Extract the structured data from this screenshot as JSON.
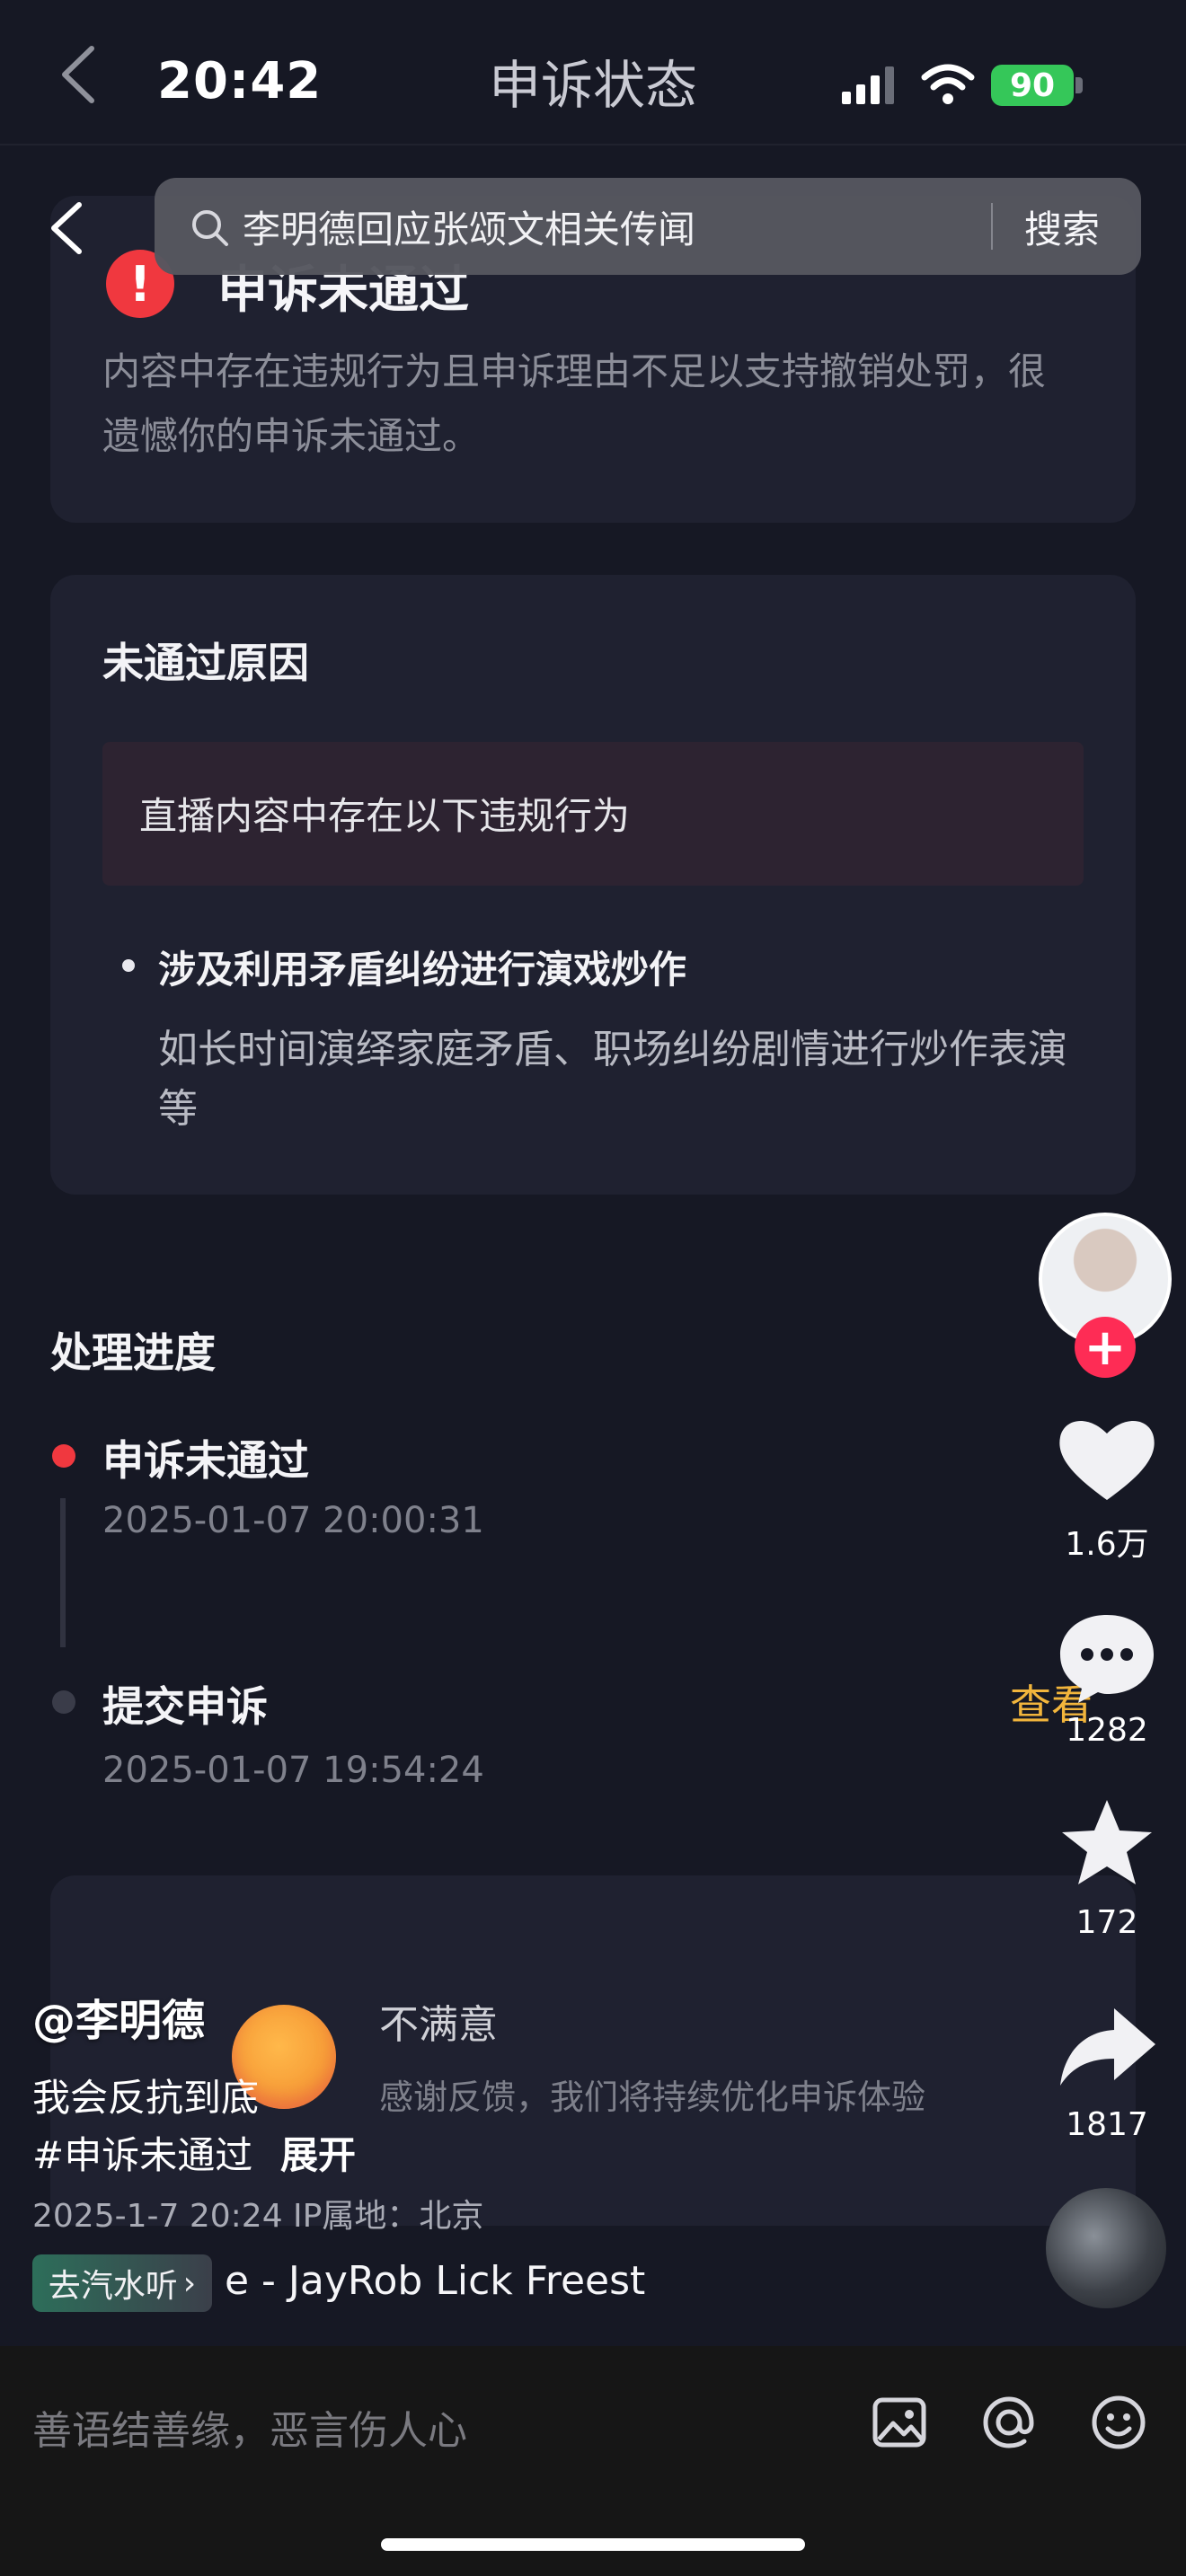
{
  "status_bar": {
    "time": "20:42",
    "battery": "90"
  },
  "header": {
    "title": "申诉状态"
  },
  "search": {
    "query": "李明德回应张颂文相关传闻",
    "button": "搜索"
  },
  "status_card": {
    "title": "申诉未通过",
    "desc": "内容中存在违规行为且申诉理由不足以支持撤销处罚，很遗憾你的申诉未通过。"
  },
  "reason_card": {
    "title": "未通过原因",
    "box_text": "直播内容中存在以下违规行为",
    "violation_title": "涉及利用矛盾纠纷进行演戏炒作",
    "violation_desc": "如长时间演绎家庭矛盾、职场纠纷剧情进行炒作表演等"
  },
  "progress": {
    "title": "处理进度",
    "steps": [
      {
        "label": "申诉未通过",
        "time": "2025-01-07 20:00:31"
      },
      {
        "label": "提交申诉",
        "time": "2025-01-07 19:54:24"
      }
    ],
    "view": "查看"
  },
  "feedback": {
    "title": "不满意",
    "desc": "感谢反馈，我们将持续优化申诉体验"
  },
  "video": {
    "author": "@李明德",
    "caption_line1": "我会反抗到底",
    "caption_line2": "#申诉未通过",
    "expand": "展开",
    "meta": "2025-1-7 20:24  IP属地：北京",
    "music_tag": "去汽水听",
    "music_text": "e - JayRob   Lick Freest"
  },
  "actions": {
    "likes": "1.6万",
    "comments": "1282",
    "favorites": "172",
    "shares": "1817"
  },
  "bottom": {
    "comment_placeholder": "善语结善缘，恶言伤人心"
  },
  "colors": {
    "alert": "#f0383f",
    "link": "#f2b53c",
    "follow": "#fe2c55",
    "battery": "#35c759"
  }
}
